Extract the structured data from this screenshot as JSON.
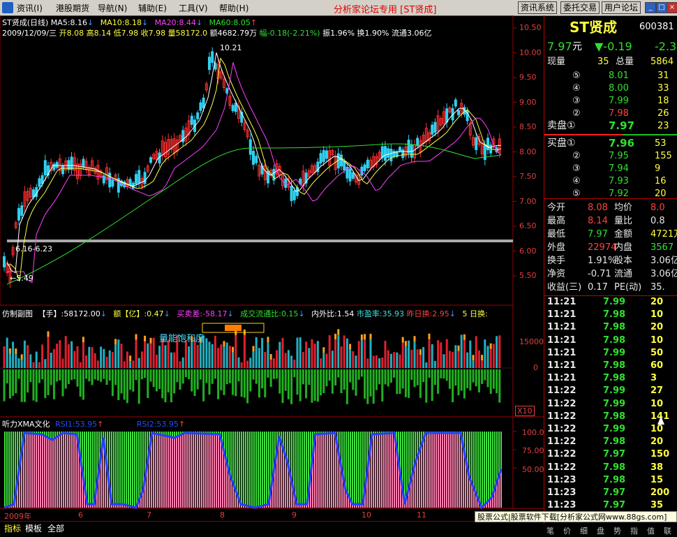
{
  "menubar": {
    "items": [
      "资讯(I)",
      "港股期货",
      "导航(N)",
      "辅助(E)",
      "工具(V)",
      "帮助(H)"
    ],
    "title": "分析家论坛专用 [ST贤成]",
    "buttons": [
      "资讯系统",
      "委托交易",
      "用户论坛"
    ]
  },
  "header": {
    "symbol_line": "ST贤成(日线)",
    "ma5": "MA5:8.16",
    "ma10": "MA10:8.18",
    "ma20": "MA20:8.44",
    "ma60": "MA60:8.05",
    "day_line": "2009/12/09/三",
    "open": "开8.08",
    "high": "高8.14",
    "low": "低7.98",
    "close": "收7.98",
    "vol": "量58172.0",
    "amount": "额4682.79万",
    "change": "幅-0.18(-2.21%)",
    "amplitude": "振1.96%",
    "turnover": "换1.90%",
    "float": "流通3.06亿"
  },
  "annotations": {
    "high_mark": "10.21",
    "range_mark": "6.16-6.23",
    "low_mark": "←5.49"
  },
  "price_axis": [
    "10.50",
    "10.00",
    "9.50",
    "9.00",
    "8.50",
    "8.00",
    "7.50",
    "7.00",
    "6.50",
    "6.00",
    "5.50"
  ],
  "sub1": {
    "title": "仿制副图",
    "hand": "【手】:58172.00",
    "amt": "额【亿】:0.47",
    "bs": "买卖差:-58.17",
    "ratio": "成交流通比:0.15",
    "inout": "内外比:1.54",
    "pe": "市盈率:35.93",
    "yest": "昨日换:2.95",
    "five": "5 日换:",
    "label": "量能饱和度",
    "axis_top": "15000",
    "axis_zero": "0",
    "scale": "X10"
  },
  "sub2": {
    "title": "听力XMA文化",
    "rsi1": "RSI1:53.95",
    "rsi2": "RSI2:53.95",
    "axis": [
      "100.0",
      "75.00",
      "50.00"
    ]
  },
  "time_axis": [
    "2009年",
    "6",
    "7",
    "8",
    "9",
    "10",
    "11"
  ],
  "tabs": [
    "指标",
    "模板",
    "全部"
  ],
  "quote": {
    "name": "ST贤成",
    "code": "600381",
    "price": "7.97",
    "unit": "元",
    "change": "▼-0.19",
    "pct": "-2.3",
    "now_vol_label": "现量",
    "now_vol": "35",
    "total_vol_label": "总量",
    "total_vol": "5864",
    "asks": [
      {
        "lvl": "⑤",
        "price": "8.01",
        "vol": "31"
      },
      {
        "lvl": "④",
        "price": "8.00",
        "vol": "33"
      },
      {
        "lvl": "③",
        "price": "7.99",
        "vol": "18"
      },
      {
        "lvl": "②",
        "price": "7.98",
        "vol": "26"
      },
      {
        "lvl": "卖盘①",
        "price": "7.97",
        "vol": "23"
      }
    ],
    "bids": [
      {
        "lvl": "买盘①",
        "price": "7.96",
        "vol": "53"
      },
      {
        "lvl": "②",
        "price": "7.95",
        "vol": "155"
      },
      {
        "lvl": "③",
        "price": "7.94",
        "vol": "9"
      },
      {
        "lvl": "④",
        "price": "7.93",
        "vol": "16"
      },
      {
        "lvl": "⑤",
        "price": "7.92",
        "vol": "20"
      }
    ],
    "stats": [
      {
        "l1": "今开",
        "v1": "8.08",
        "c1": "r",
        "l2": "均价",
        "v2": "8.0",
        "c2": "r"
      },
      {
        "l1": "最高",
        "v1": "8.14",
        "c1": "r",
        "l2": "量比",
        "v2": "0.8",
        "c2": "w"
      },
      {
        "l1": "最低",
        "v1": "7.97",
        "c1": "g",
        "l2": "金额",
        "v2": "4721万",
        "c2": "y"
      },
      {
        "l1": "外盘",
        "v1": "22974",
        "c1": "r",
        "l2": "内盘",
        "v2": "3567",
        "c2": "g"
      },
      {
        "l1": "换手",
        "v1": "1.91%",
        "c1": "w",
        "l2": "股本",
        "v2": "3.06亿",
        "c2": "w"
      },
      {
        "l1": "净资",
        "v1": "-0.71",
        "c1": "w",
        "l2": "流通",
        "v2": "3.06亿",
        "c2": "w"
      },
      {
        "l1": "收益(三)",
        "v1": "0.17",
        "c1": "w",
        "l2": "PE(动)",
        "v2": "35.",
        "c2": "w"
      }
    ],
    "ticks": [
      {
        "t": "11:21",
        "p": "7.99",
        "v": "20"
      },
      {
        "t": "11:21",
        "p": "7.98",
        "v": "10"
      },
      {
        "t": "11:21",
        "p": "7.98",
        "v": "20"
      },
      {
        "t": "11:21",
        "p": "7.98",
        "v": "10"
      },
      {
        "t": "11:21",
        "p": "7.99",
        "v": "50"
      },
      {
        "t": "11:21",
        "p": "7.98",
        "v": "60"
      },
      {
        "t": "11:21",
        "p": "7.98",
        "v": "3"
      },
      {
        "t": "11:22",
        "p": "7.99",
        "v": "27"
      },
      {
        "t": "11:22",
        "p": "7.99",
        "v": "10"
      },
      {
        "t": "11:22",
        "p": "7.98",
        "v": "141"
      },
      {
        "t": "11:22",
        "p": "7.99",
        "v": "10"
      },
      {
        "t": "11:22",
        "p": "7.98",
        "v": "20"
      },
      {
        "t": "11:22",
        "p": "7.97",
        "v": "150"
      },
      {
        "t": "11:22",
        "p": "7.98",
        "v": "38"
      },
      {
        "t": "11:23",
        "p": "7.98",
        "v": "15"
      },
      {
        "t": "11:23",
        "p": "7.97",
        "v": "200"
      },
      {
        "t": "11:23",
        "p": "7.97",
        "v": "35"
      }
    ]
  },
  "status_banner": "股票公式|股票软件下载[分析家公式网www.88gs.com]",
  "bottom_strip": [
    "笔",
    "价",
    "细",
    "盘",
    "势",
    "指",
    "值",
    "联"
  ],
  "colors": {
    "up": "#ff4040",
    "down": "#30e030",
    "ma5": "#ffffff",
    "ma10": "#ffff40",
    "ma20": "#ff40ff",
    "ma60": "#30e030",
    "rsi_up": "#ff80b0",
    "rsi_line": "#2040ff"
  }
}
